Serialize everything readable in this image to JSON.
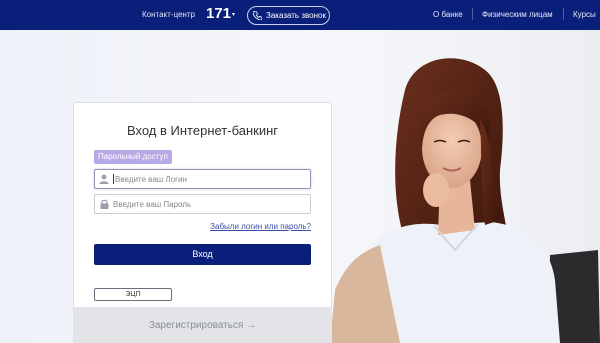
{
  "topbar": {
    "contact_label": "Контакт-центр",
    "phone": "171",
    "caret": "▾",
    "callback_label": "Заказать звонок",
    "nav": [
      "О банке",
      "Физическим лицам",
      "Курсы"
    ]
  },
  "login": {
    "title": "Вход в Интернет-банкинг",
    "mode_badge": "Парольный доступ",
    "login_placeholder": "Введите ваш Логин",
    "password_placeholder": "Введите ваш Пароль",
    "forgot_link": "Забыли логин или пароль?",
    "submit_label": "Вход",
    "ecp_label": "ЭЦП",
    "register_label": "Зарегистрироваться →"
  },
  "colors": {
    "brand": "#0a1f7a",
    "badge": "#b7a8e6",
    "link": "#3b4fa6"
  }
}
